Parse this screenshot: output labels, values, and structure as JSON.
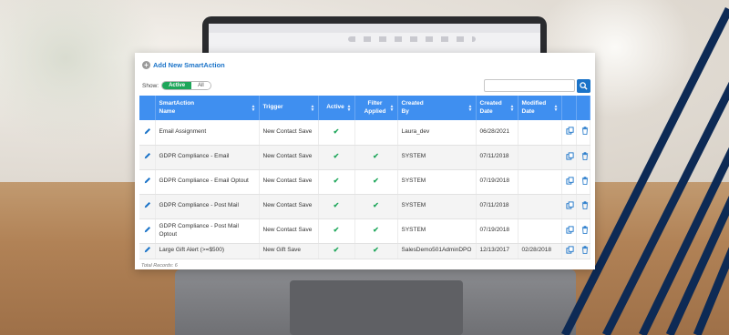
{
  "panel": {
    "add_action_label": "Add New SmartAction",
    "show_label": "Show:",
    "filter_active": "Active",
    "filter_all": "All",
    "search_placeholder": ""
  },
  "table": {
    "headers": [
      {
        "label": "SmartAction\nName",
        "key": "name"
      },
      {
        "label": "Trigger",
        "key": "trigger"
      },
      {
        "label": "Active",
        "key": "active"
      },
      {
        "label": "Filter\nApplied",
        "key": "filter"
      },
      {
        "label": "Created\nBy",
        "key": "created_by"
      },
      {
        "label": "Created\nDate",
        "key": "created_date"
      },
      {
        "label": "Modified\nDate",
        "key": "modified_date"
      }
    ],
    "rows": [
      {
        "name": "Email Assignment",
        "trigger": "New Contact Save",
        "active": true,
        "filter": false,
        "created_by": "Laura_dev",
        "created_date": "06/28/2021",
        "modified_date": ""
      },
      {
        "name": "GDPR Compliance - Email",
        "trigger": "New Contact Save",
        "active": true,
        "filter": true,
        "created_by": "SYSTEM",
        "created_date": "07/11/2018",
        "modified_date": ""
      },
      {
        "name": "GDPR Compliance - Email Optout",
        "trigger": "New Contact Save",
        "active": true,
        "filter": true,
        "created_by": "SYSTEM",
        "created_date": "07/19/2018",
        "modified_date": ""
      },
      {
        "name": "GDPR Compliance - Post Mail",
        "trigger": "New Contact Save",
        "active": true,
        "filter": true,
        "created_by": "SYSTEM",
        "created_date": "07/11/2018",
        "modified_date": ""
      },
      {
        "name": "GDPR Compliance - Post Mail Optout",
        "trigger": "New Contact Save",
        "active": true,
        "filter": true,
        "created_by": "SYSTEM",
        "created_date": "07/19/2018",
        "modified_date": ""
      },
      {
        "name": "Large Gift Alert (>=$500)",
        "trigger": "New Gift Save",
        "active": true,
        "filter": true,
        "created_by": "SalesDemo501AdminDPO",
        "created_date": "12/13/2017",
        "modified_date": "02/28/2018"
      }
    ],
    "check_glyph": "✔",
    "icons": {
      "edit": "pencil-icon",
      "copy": "copy-icon",
      "delete": "trash-icon",
      "search": "search-icon",
      "add": "plus-circle-icon"
    }
  },
  "footer": {
    "total_records": "Total Records: 6"
  },
  "colors": {
    "header_blue": "#3f8ff0",
    "link_blue": "#1a73c8",
    "check_green": "#1ea65a",
    "stripe_navy": "#0d2a55"
  }
}
